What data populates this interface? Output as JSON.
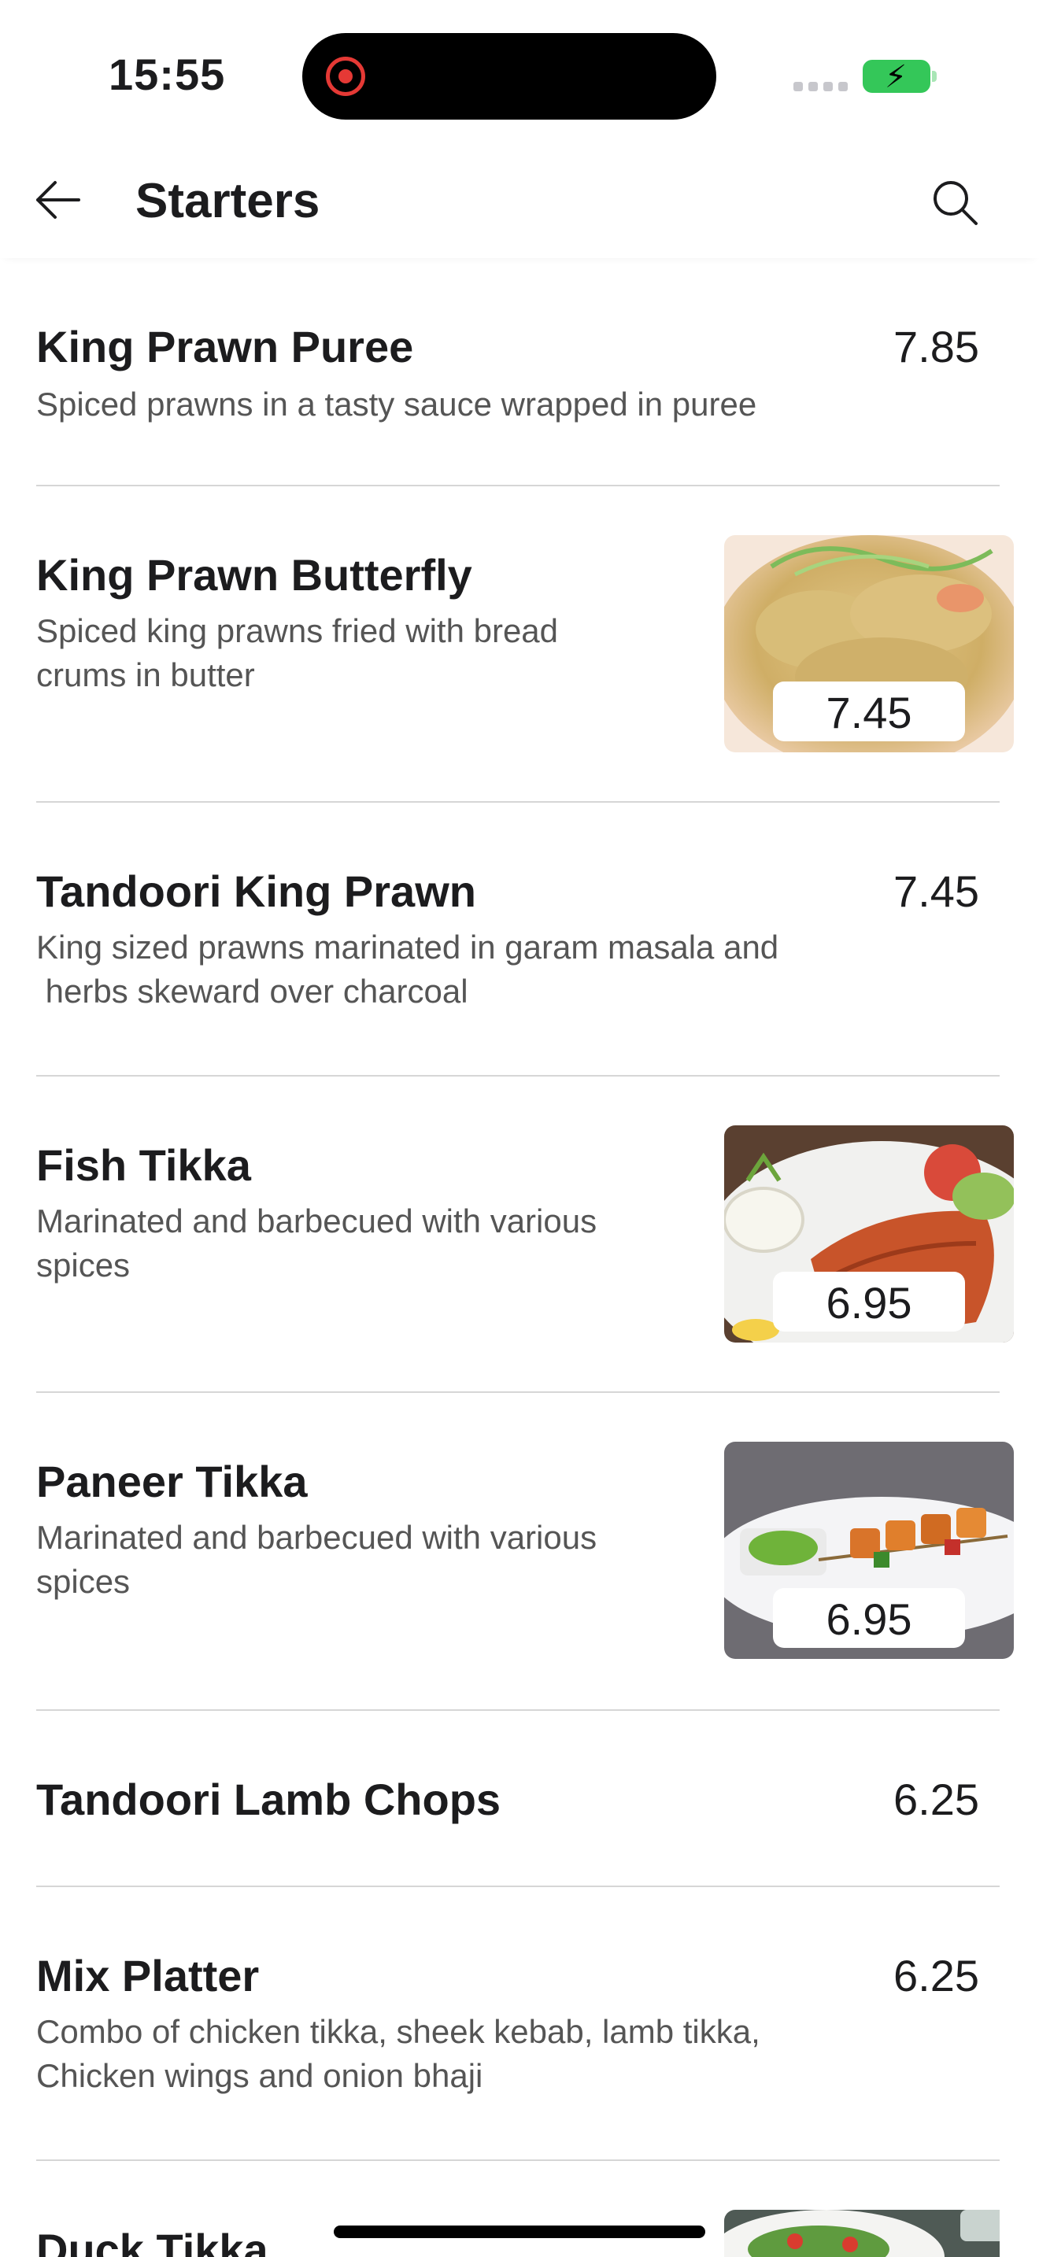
{
  "status": {
    "time": "15:55",
    "battery_color": "#34c759"
  },
  "header": {
    "title": "Starters",
    "back_icon": "arrow-left-icon",
    "search_icon": "search-icon"
  },
  "items": [
    {
      "name": "King Prawn Puree",
      "desc": "Spiced prawns in a tasty sauce wrapped in puree",
      "price": "7.85",
      "image": null
    },
    {
      "name": "King Prawn Butterfly",
      "desc": "Spiced king prawns fried with bread\ncrums in butter",
      "price": "7.45",
      "image": "fried-prawns-image"
    },
    {
      "name": "Tandoori King Prawn",
      "desc": "King sized prawns marinated in garam masala and\n herbs skeward over charcoal",
      "price": "7.45",
      "image": null
    },
    {
      "name": "Fish Tikka",
      "desc": "Marinated and barbecued with various\nspices",
      "price": "6.95",
      "image": "fish-tikka-image"
    },
    {
      "name": "Paneer Tikka",
      "desc": "Marinated and barbecued with various\nspices",
      "price": "6.95",
      "image": "paneer-tikka-image"
    },
    {
      "name": "Tandoori Lamb Chops",
      "desc": "",
      "price": "6.25",
      "image": null
    },
    {
      "name": "Mix Platter",
      "desc": "Combo of chicken tikka, sheek kebab, lamb tikka,\nChicken wings and onion bhaji",
      "price": "6.25",
      "image": null
    },
    {
      "name": "Duck Tikka",
      "desc": "",
      "price": "",
      "image": "duck-tikka-image"
    }
  ]
}
